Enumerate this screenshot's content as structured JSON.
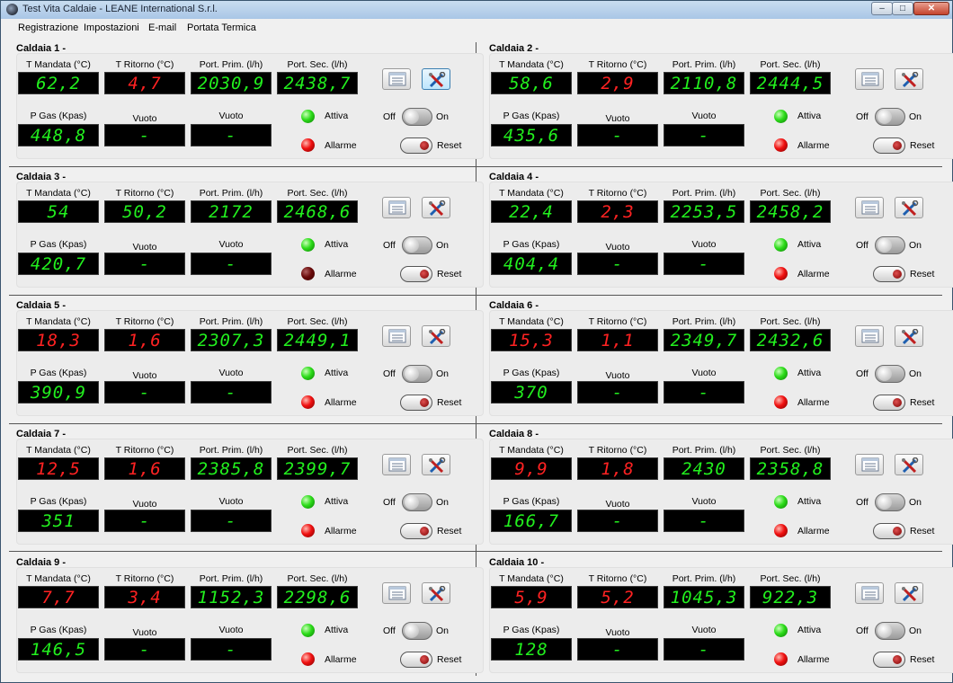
{
  "window": {
    "title": "Test Vita Caldaie - LEANE International S.r.l.",
    "min_glyph": "–",
    "max_glyph": "□",
    "close_glyph": "✕"
  },
  "menu": [
    "Registrazione",
    "Impostazioni",
    "E-mail",
    "Portata Termica"
  ],
  "labels": {
    "t_mandata": "T Mandata (°C)",
    "t_ritorno": "T Ritorno (°C)",
    "port_prim": "Port. Prim. (l/h)",
    "port_sec": "Port. Sec. (l/h)",
    "p_gas": "P Gas (Kpas)",
    "vuoto": "Vuoto",
    "attiva": "Attiva",
    "allarme": "Allarme",
    "off": "Off",
    "on": "On",
    "reset": "Reset"
  },
  "colors": {
    "display_green": "#22f01e",
    "display_red": "#ff2222",
    "led_green": "#2ddc1a",
    "led_red": "#f01010",
    "led_dark_red": "#6a0a0a"
  },
  "boilers": [
    {
      "title": "Caldaia 1 -",
      "t_mandata": {
        "value": "62,2",
        "color": "green"
      },
      "t_ritorno": {
        "value": "4,7",
        "color": "red"
      },
      "port_prim": "2030,9",
      "port_sec": "2438,7",
      "p_gas": "448,8",
      "vuoto1": "-",
      "vuoto2": "-",
      "attiva_led": "on",
      "allarme_led": "on",
      "settings_active": true
    },
    {
      "title": "Caldaia 2 -",
      "t_mandata": {
        "value": "58,6",
        "color": "green"
      },
      "t_ritorno": {
        "value": "2,9",
        "color": "red"
      },
      "port_prim": "2110,8",
      "port_sec": "2444,5",
      "p_gas": "435,6",
      "vuoto1": "-",
      "vuoto2": "-",
      "attiva_led": "on",
      "allarme_led": "on",
      "settings_active": false
    },
    {
      "title": "Caldaia 3 -",
      "t_mandata": {
        "value": "54",
        "color": "green"
      },
      "t_ritorno": {
        "value": "50,2",
        "color": "green"
      },
      "port_prim": "2172",
      "port_sec": "2468,6",
      "p_gas": "420,7",
      "vuoto1": "-",
      "vuoto2": "-",
      "attiva_led": "on",
      "allarme_led": "off",
      "settings_active": false
    },
    {
      "title": "Caldaia 4 -",
      "t_mandata": {
        "value": "22,4",
        "color": "green"
      },
      "t_ritorno": {
        "value": "2,3",
        "color": "red"
      },
      "port_prim": "2253,5",
      "port_sec": "2458,2",
      "p_gas": "404,4",
      "vuoto1": "-",
      "vuoto2": "-",
      "attiva_led": "on",
      "allarme_led": "on",
      "settings_active": false
    },
    {
      "title": "Caldaia 5 -",
      "t_mandata": {
        "value": "18,3",
        "color": "red"
      },
      "t_ritorno": {
        "value": "1,6",
        "color": "red"
      },
      "port_prim": "2307,3",
      "port_sec": "2449,1",
      "p_gas": "390,9",
      "vuoto1": "-",
      "vuoto2": "-",
      "attiva_led": "on",
      "allarme_led": "on",
      "settings_active": false
    },
    {
      "title": "Caldaia 6 -",
      "t_mandata": {
        "value": "15,3",
        "color": "red"
      },
      "t_ritorno": {
        "value": "1,1",
        "color": "red"
      },
      "port_prim": "2349,7",
      "port_sec": "2432,6",
      "p_gas": "370",
      "vuoto1": "-",
      "vuoto2": "-",
      "attiva_led": "on",
      "allarme_led": "on",
      "settings_active": false
    },
    {
      "title": "Caldaia 7 -",
      "t_mandata": {
        "value": "12,5",
        "color": "red"
      },
      "t_ritorno": {
        "value": "1,6",
        "color": "red"
      },
      "port_prim": "2385,8",
      "port_sec": "2399,7",
      "p_gas": "351",
      "vuoto1": "-",
      "vuoto2": "-",
      "attiva_led": "on",
      "allarme_led": "on",
      "settings_active": false
    },
    {
      "title": "Caldaia 8 -",
      "t_mandata": {
        "value": "9,9",
        "color": "red"
      },
      "t_ritorno": {
        "value": "1,8",
        "color": "red"
      },
      "port_prim": "2430",
      "port_sec": "2358,8",
      "p_gas": "166,7",
      "vuoto1": "-",
      "vuoto2": "-",
      "attiva_led": "on",
      "allarme_led": "on",
      "settings_active": false
    },
    {
      "title": "Caldaia 9 -",
      "t_mandata": {
        "value": "7,7",
        "color": "red"
      },
      "t_ritorno": {
        "value": "3,4",
        "color": "red"
      },
      "port_prim": "1152,3",
      "port_sec": "2298,6",
      "p_gas": "146,5",
      "vuoto1": "-",
      "vuoto2": "-",
      "attiva_led": "on",
      "allarme_led": "on",
      "settings_active": false
    },
    {
      "title": "Caldaia 10 -",
      "t_mandata": {
        "value": "5,9",
        "color": "red"
      },
      "t_ritorno": {
        "value": "5,2",
        "color": "red"
      },
      "port_prim": "1045,3",
      "port_sec": "922,3",
      "p_gas": "128",
      "vuoto1": "-",
      "vuoto2": "-",
      "attiva_led": "on",
      "allarme_led": "on",
      "settings_active": false
    }
  ]
}
